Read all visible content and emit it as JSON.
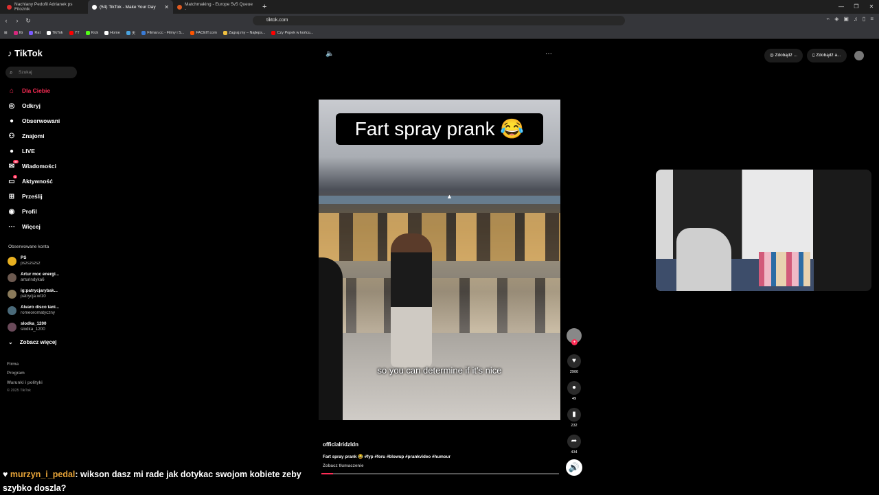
{
  "browser": {
    "tabs": [
      {
        "title": "Nachlany Pedofil Adrianek ps Fitoznik",
        "fav_color": "#e03030"
      },
      {
        "title": "(54) TikTok - Make Your Day",
        "fav_color": "#ffffff"
      },
      {
        "title": "Matchmaking - Europe 5v5 Queue -",
        "fav_color": "#e05a20"
      }
    ],
    "url": "tiktok.com",
    "bookmarks": [
      {
        "label": "IG",
        "color": "#d6287d"
      },
      {
        "label": "Rat",
        "color": "#7b5cff"
      },
      {
        "label": "TikTok",
        "color": "#ffffff"
      },
      {
        "label": "YT",
        "color": "#ff0000"
      },
      {
        "label": "Kick",
        "color": "#53fc18"
      },
      {
        "label": "Home",
        "color": "#ffffff"
      },
      {
        "label": "天",
        "color": "#4aa3df"
      },
      {
        "label": "Filman.cc - Filmy i S...",
        "color": "#3a7bd5"
      },
      {
        "label": "FACEIT.com",
        "color": "#ff5500"
      },
      {
        "label": "Zagraj.my – Najleps...",
        "color": "#f0c040"
      },
      {
        "label": "Czy Popek w końcu...",
        "color": "#ff0000"
      }
    ]
  },
  "sidebar": {
    "logo": "TikTok",
    "search_placeholder": "Szukaj",
    "nav": [
      {
        "label": "Dla Ciebie",
        "icon": "home-icon",
        "glyph": "⌂"
      },
      {
        "label": "Odkryj",
        "icon": "compass-icon",
        "glyph": "◎"
      },
      {
        "label": "Obserwowani",
        "icon": "following-icon",
        "glyph": "●"
      },
      {
        "label": "Znajomi",
        "icon": "friends-icon",
        "glyph": "⚇"
      },
      {
        "label": "LIVE",
        "icon": "live-icon",
        "glyph": "●"
      },
      {
        "label": "Wiadomości",
        "icon": "messages-icon",
        "glyph": "✉",
        "badge": "99"
      },
      {
        "label": "Aktywność",
        "icon": "activity-icon",
        "glyph": "▭",
        "badge": "6"
      },
      {
        "label": "Prześlij",
        "icon": "upload-icon",
        "glyph": "⊞"
      },
      {
        "label": "Profil",
        "icon": "profile-icon",
        "glyph": "◉"
      },
      {
        "label": "Więcej",
        "icon": "more-icon",
        "glyph": "⋯"
      }
    ],
    "followed_title": "Obserwowane konta",
    "followed": [
      {
        "name": "PS",
        "handle": "pszszszsz"
      },
      {
        "name": "Artur moc energi...",
        "handle": "arturindyka6"
      },
      {
        "name": "ig:patrycjarybak...",
        "handle": "patrycja.wl10"
      },
      {
        "name": "Alvaro disco tani...",
        "handle": "romeoromatyczny"
      },
      {
        "name": "slodka_1200",
        "handle": "slodka_1200"
      }
    ],
    "see_more": "Zobacz więcej",
    "footer": [
      "Firma",
      "Program",
      "Warunki i polityki"
    ],
    "copyright": "© 2025 TikTok"
  },
  "header": {
    "get_coins": "Zdobądź ...",
    "get_app": "Zdobądź a..."
  },
  "video": {
    "caption_overlay": "Fart spray prank 😂",
    "subtitle": "so you can determine if it's nice",
    "author": "officialridzldn",
    "description": "Fart spray prank 😂 #fyp #foru #blowup #prankvideo #humour",
    "translate": "Zobacz tłumaczenie",
    "likes": "2900",
    "comments": "49",
    "saves": "232",
    "shares": "434",
    "progress": 0.05
  },
  "chat": {
    "user": "murzyn_i_pedal",
    "message": ": wikson dasz mi rade jak dotykac swojom kobiete zeby szybko doszla?"
  }
}
